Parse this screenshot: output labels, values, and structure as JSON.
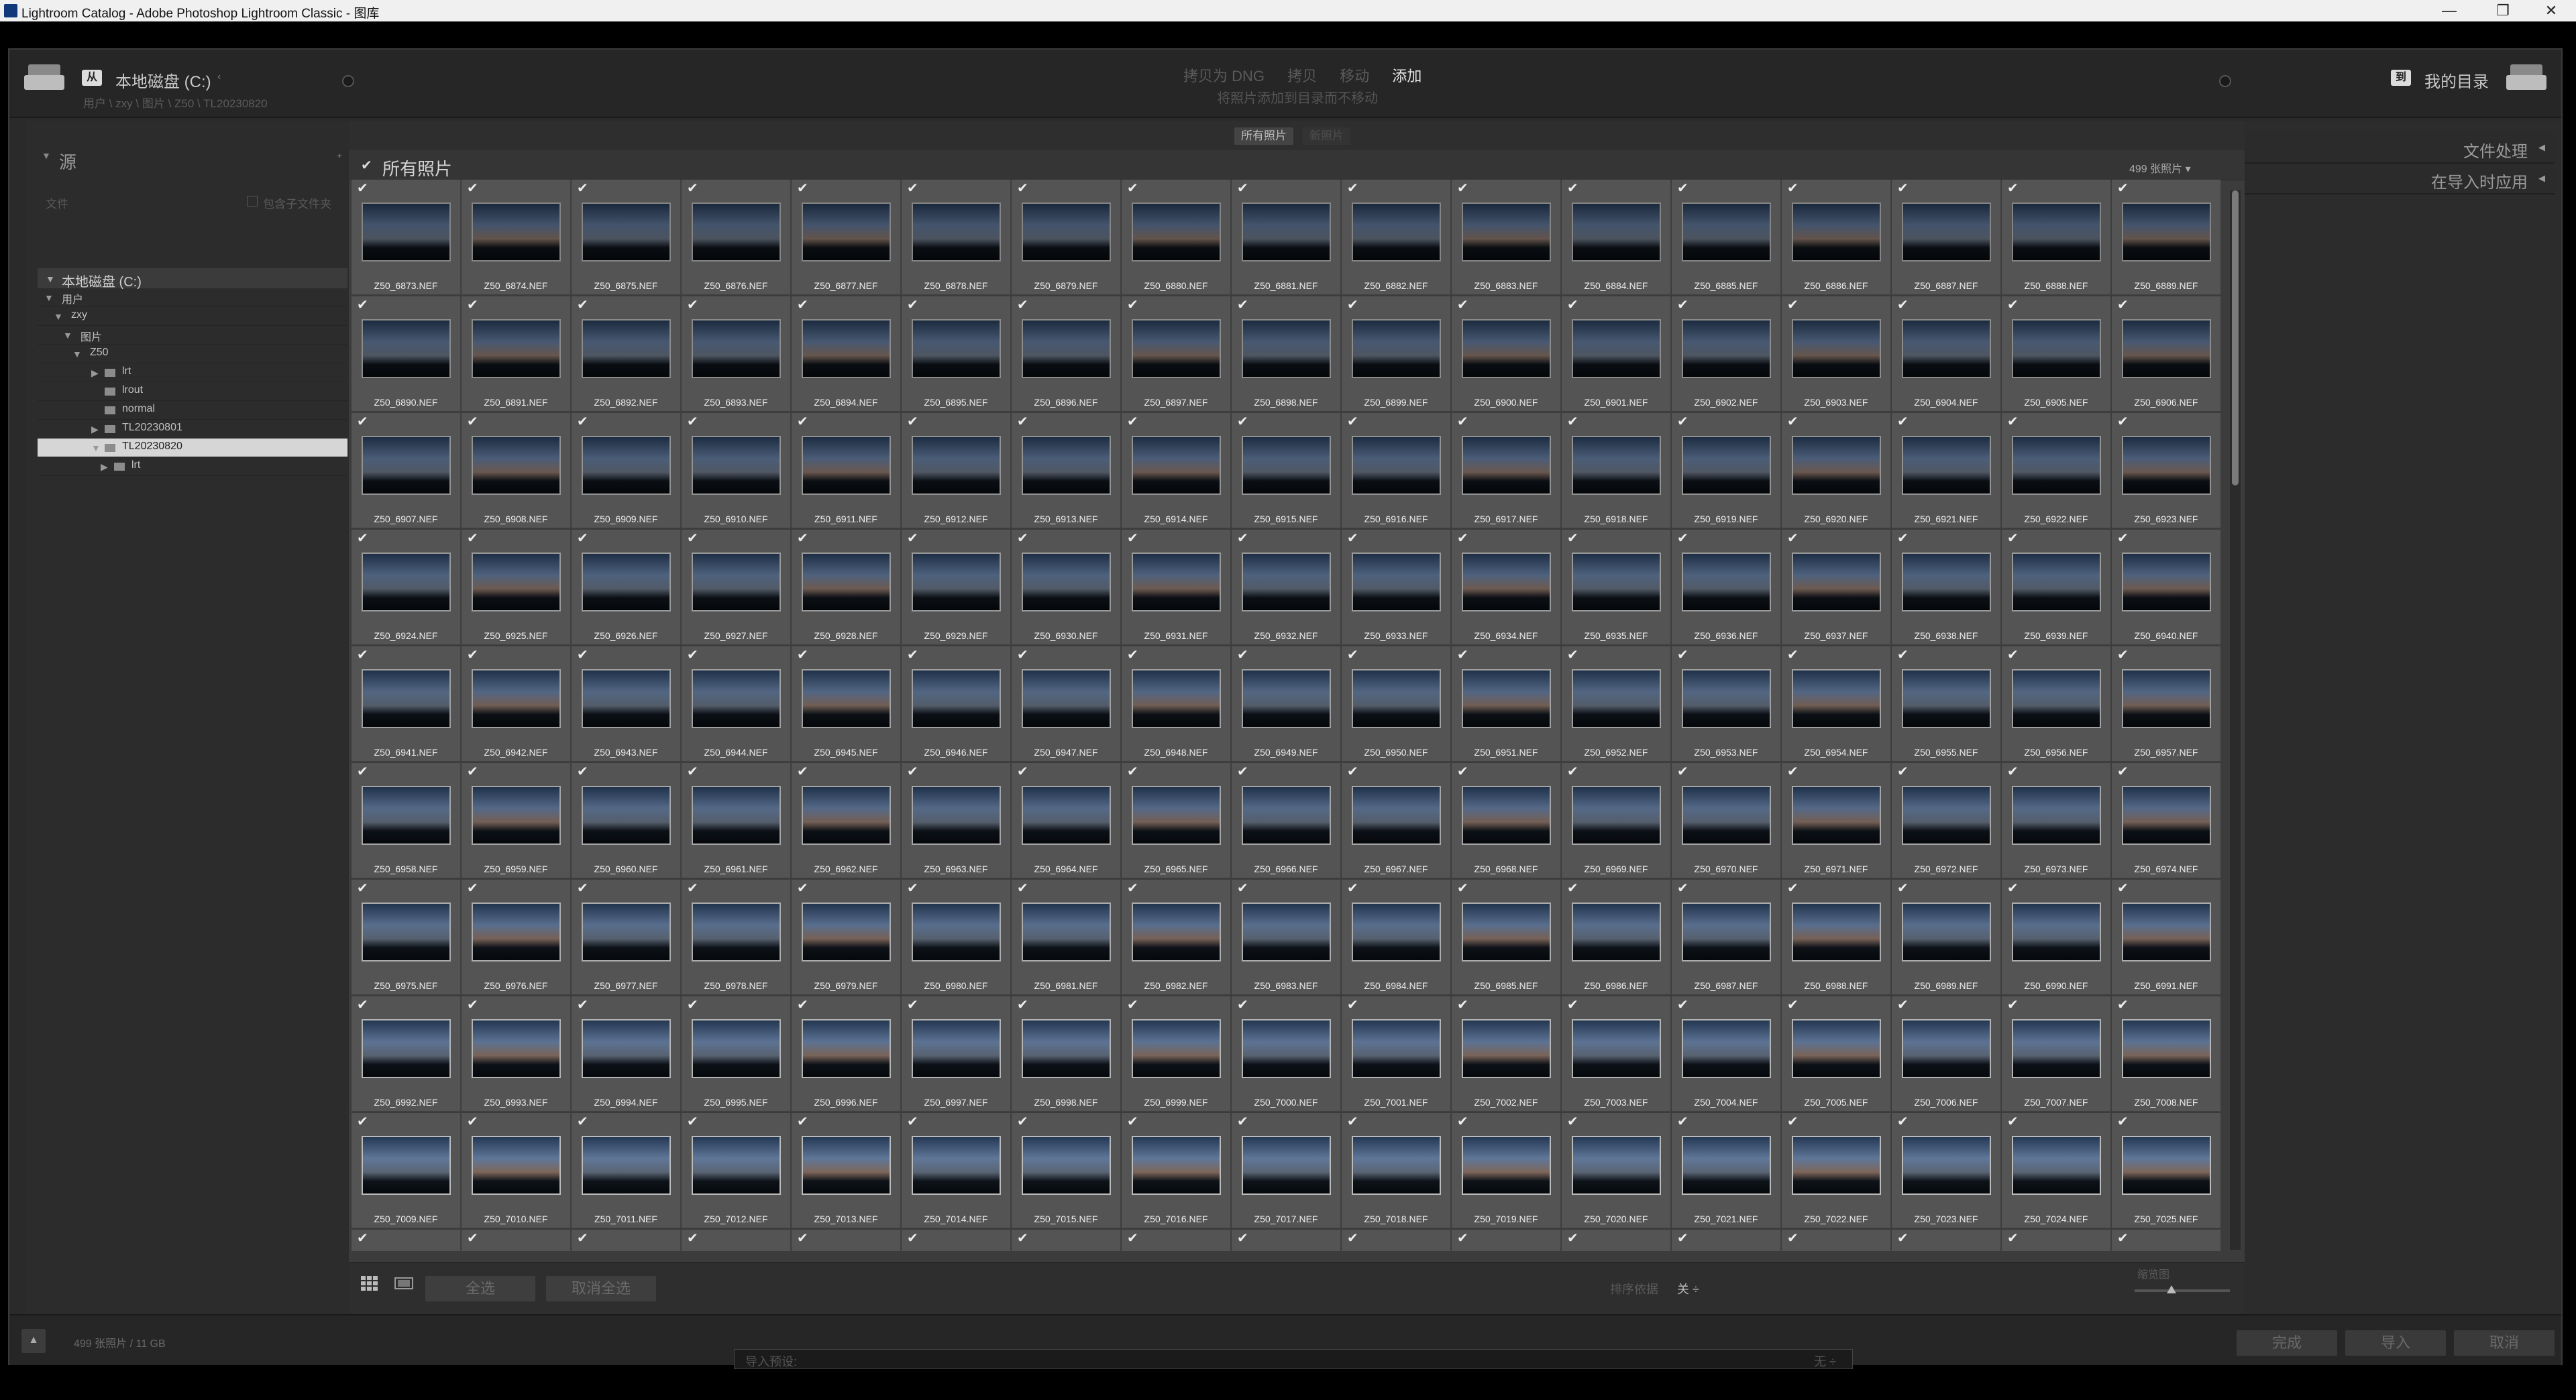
{
  "window": {
    "title": "Lightroom Catalog - Adobe Photoshop Lightroom Classic - 图库",
    "controls": [
      "—",
      "❐",
      "✕"
    ]
  },
  "topbar": {
    "source_badge": "从",
    "source_name": "本地磁盘 (C:)",
    "source_path": "用户 \\ zxy \\ 图片 \\ Z50 \\ TL20230820",
    "modes": [
      "拷贝为 DNG",
      "拷贝",
      "移动",
      "添加"
    ],
    "active_mode": "添加",
    "mode_description": "将照片添加到目录而不移动",
    "dest_badge": "到",
    "dest_name": "我的目录"
  },
  "left_panel": {
    "title": "源",
    "files_label": "文件",
    "include_subfolders": "包含子文件夹",
    "root": "本地磁盘 (C:)",
    "tree": [
      {
        "label": "用户",
        "indent": 0,
        "expanded": true,
        "folder": false
      },
      {
        "label": "zxy",
        "indent": 1,
        "expanded": true,
        "folder": false
      },
      {
        "label": "图片",
        "indent": 2,
        "expanded": true,
        "folder": false
      },
      {
        "label": "Z50",
        "indent": 3,
        "expanded": true,
        "folder": false
      },
      {
        "label": "lrt",
        "indent": 4,
        "expanded": false,
        "folder": true,
        "has_children": true
      },
      {
        "label": "lrout",
        "indent": 4,
        "expanded": false,
        "folder": true,
        "has_children": false
      },
      {
        "label": "normal",
        "indent": 4,
        "expanded": false,
        "folder": true,
        "has_children": false
      },
      {
        "label": "TL20230801",
        "indent": 4,
        "expanded": false,
        "folder": true,
        "has_children": true
      },
      {
        "label": "TL20230820",
        "indent": 4,
        "expanded": true,
        "folder": true,
        "has_children": true,
        "selected": true
      },
      {
        "label": "lrt",
        "indent": 5,
        "expanded": false,
        "folder": true,
        "has_children": true
      }
    ]
  },
  "center": {
    "tabs": [
      "所有照片",
      "新照片"
    ],
    "grid_title": "所有照片",
    "photo_count": "499 张照片",
    "first_photo_number": 6873,
    "columns": 17,
    "visible_rows": 10,
    "file_prefix": "Z50_",
    "file_ext": ".NEF",
    "check_all": "全选",
    "uncheck_all": "取消全选",
    "sort_label": "排序依据",
    "sort_value": "关",
    "thumb_label": "缩览图"
  },
  "right_panel": {
    "sections": [
      "文件处理",
      "在导入时应用"
    ]
  },
  "footer": {
    "info": "499 张照片 / 11 GB",
    "preset_label": "导入预设:",
    "preset_value": "无 ÷",
    "buttons": [
      "完成",
      "导入",
      "取消"
    ]
  },
  "colors": {
    "sky_top": "#233650",
    "sky_mid": "#5a7090",
    "sky_bottom": "#0d1218",
    "cell_bg": "#545454",
    "panel_bg": "#2c2c2c"
  }
}
